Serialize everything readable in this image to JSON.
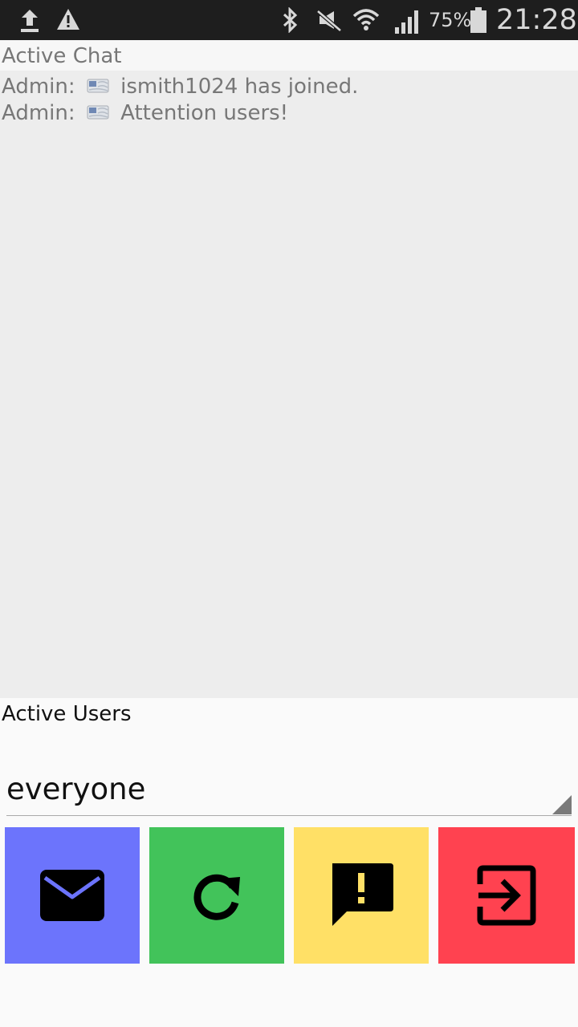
{
  "status_bar": {
    "battery_percent": "75%",
    "time": "21:28",
    "icons": [
      "upload-icon",
      "warning-icon",
      "bluetooth-icon",
      "mute-icon",
      "wifi-icon",
      "signal-icon",
      "battery-icon"
    ]
  },
  "header": {
    "title": "Active Chat"
  },
  "chat": {
    "messages": [
      {
        "sender": "Admin:",
        "text": "ismith1024 has joined."
      },
      {
        "sender": "Admin:",
        "text": "Attention users!"
      }
    ]
  },
  "users": {
    "label": "Active Users",
    "selected": "everyone"
  },
  "actions": [
    {
      "icon": "mail-icon",
      "color": "#6c74fc"
    },
    {
      "icon": "refresh-icon",
      "color": "#42c35a"
    },
    {
      "icon": "alert-message-icon",
      "color": "#ffe066"
    },
    {
      "icon": "exit-icon",
      "color": "#ff4250"
    }
  ]
}
